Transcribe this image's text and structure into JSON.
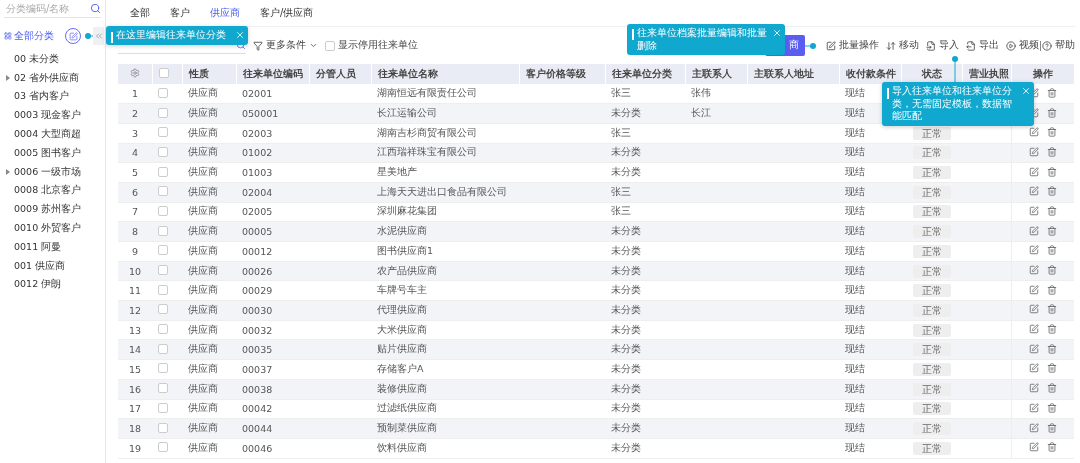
{
  "sidebar": {
    "search": {
      "placeholder": "分类编码/名称"
    },
    "tree": {
      "label": "全部分类",
      "selected": true,
      "children": [
        {
          "label": "00 未分类",
          "selected": false,
          "has_children": false
        },
        {
          "label": "02 省外供应商",
          "selected": false,
          "has_children": true
        },
        {
          "label": "03 省内客户",
          "selected": false,
          "has_children": false
        },
        {
          "label": "0003 现金客户",
          "selected": false,
          "has_children": false
        },
        {
          "label": "0004 大型商超",
          "selected": false,
          "has_children": false
        },
        {
          "label": "0005 图书客户",
          "selected": false,
          "has_children": false
        },
        {
          "label": "0006 一级市场",
          "selected": false,
          "has_children": true
        },
        {
          "label": "0008 北京客户",
          "selected": false,
          "has_children": false
        },
        {
          "label": "0009 苏州客户",
          "selected": false,
          "has_children": false
        },
        {
          "label": "0010 外贸客户",
          "selected": false,
          "has_children": false
        },
        {
          "label": "0011 阿曼",
          "selected": false,
          "has_children": false
        },
        {
          "label": "001 供应商",
          "selected": false,
          "has_children": false
        },
        {
          "label": "0012 伊朗",
          "selected": false,
          "has_children": false
        }
      ]
    }
  },
  "tabs": [
    {
      "label": "全部",
      "selected": false
    },
    {
      "label": "客户",
      "selected": false
    },
    {
      "label": "供应商",
      "selected": true
    },
    {
      "label": "客户/供应商",
      "selected": false
    }
  ],
  "toolbar": {
    "more_filters": "更多条件",
    "show_disabled": {
      "label": "显示停用往来单位",
      "checked": false
    },
    "primary_button": "商",
    "actions": [
      {
        "kind": "batch",
        "label": "批量操作"
      },
      {
        "kind": "move",
        "label": "移动"
      },
      {
        "kind": "import",
        "label": "导入"
      },
      {
        "kind": "export",
        "label": "导出"
      },
      {
        "kind": "video",
        "label": "视频"
      },
      {
        "kind": "help",
        "label": "帮助"
      }
    ]
  },
  "table": {
    "header_checked": false,
    "columns": [
      "性质",
      "往来单位编码",
      "分管人员",
      "往来单位名称",
      "客户价格等级",
      "往来单位分类",
      "主联系人",
      "主联系人地址",
      "收付款条件",
      "状态",
      "营业执照",
      "操作"
    ],
    "rows": [
      {
        "no": "1",
        "checked": false,
        "type": "供应商",
        "code": "02001",
        "name": "湖南恒远有限责任公司",
        "category": "张三",
        "contact": "张伟",
        "terms": "现结"
      },
      {
        "no": "2",
        "checked": false,
        "type": "供应商",
        "code": "050001",
        "name": "长江运输公司",
        "category": "未分类",
        "contact": "长江",
        "terms": "现结"
      },
      {
        "no": "3",
        "checked": false,
        "type": "供应商",
        "code": "02003",
        "name": "湖南吉杉商贸有限公司",
        "category": "张三",
        "terms": "现结",
        "status": "正常"
      },
      {
        "no": "4",
        "checked": false,
        "type": "供应商",
        "code": "01002",
        "name": "江西瑞祥珠宝有限公司",
        "category": "未分类",
        "terms": "现结",
        "status": "正常"
      },
      {
        "no": "5",
        "checked": false,
        "type": "供应商",
        "code": "01003",
        "name": "星美地产",
        "category": "未分类",
        "terms": "现结",
        "status": "正常"
      },
      {
        "no": "6",
        "checked": false,
        "type": "供应商",
        "code": "02004",
        "name": "上海天天进出口食品有限公司",
        "category": "张三",
        "terms": "现结",
        "status": "正常"
      },
      {
        "no": "7",
        "checked": false,
        "type": "供应商",
        "code": "02005",
        "name": "深圳麻花集团",
        "category": "张三",
        "terms": "现结",
        "status": "正常"
      },
      {
        "no": "8",
        "checked": false,
        "type": "供应商",
        "code": "00005",
        "name": "水泥供应商",
        "category": "未分类",
        "terms": "现结",
        "status": "正常"
      },
      {
        "no": "9",
        "checked": false,
        "type": "供应商",
        "code": "00012",
        "name": "图书供应商1",
        "category": "未分类",
        "terms": "现结",
        "status": "正常"
      },
      {
        "no": "10",
        "checked": false,
        "type": "供应商",
        "code": "00026",
        "name": "农产品供应商",
        "category": "未分类",
        "terms": "现结",
        "status": "正常"
      },
      {
        "no": "11",
        "checked": false,
        "type": "供应商",
        "code": "00029",
        "name": "车牌号车主",
        "category": "未分类",
        "terms": "现结",
        "status": "正常"
      },
      {
        "no": "12",
        "checked": false,
        "type": "供应商",
        "code": "00030",
        "name": "代理供应商",
        "category": "未分类",
        "terms": "现结",
        "status": "正常"
      },
      {
        "no": "13",
        "checked": false,
        "type": "供应商",
        "code": "00032",
        "name": "大米供应商",
        "category": "未分类",
        "terms": "现结",
        "status": "正常"
      },
      {
        "no": "14",
        "checked": false,
        "type": "供应商",
        "code": "00035",
        "name": "贴片供应商",
        "category": "未分类",
        "terms": "现结",
        "status": "正常"
      },
      {
        "no": "15",
        "checked": false,
        "type": "供应商",
        "code": "00037",
        "name": "存储客户A",
        "category": "未分类",
        "terms": "现结",
        "status": "正常"
      },
      {
        "no": "16",
        "checked": false,
        "type": "供应商",
        "code": "00038",
        "name": "装修供应商",
        "category": "未分类",
        "terms": "现结",
        "status": "正常"
      },
      {
        "no": "17",
        "checked": false,
        "type": "供应商",
        "code": "00042",
        "name": "过滤纸供应商",
        "category": "未分类",
        "terms": "现结",
        "status": "正常"
      },
      {
        "no": "18",
        "checked": false,
        "type": "供应商",
        "code": "00044",
        "name": "预制菜供应商",
        "category": "未分类",
        "terms": "现结",
        "status": "正常"
      },
      {
        "no": "19",
        "checked": false,
        "type": "供应商",
        "code": "00046",
        "name": "饮料供应商",
        "category": "未分类",
        "terms": "现结",
        "status": "正常"
      }
    ]
  },
  "tips": [
    {
      "kind": "category",
      "text": "在这里编辑往来单位分类"
    },
    {
      "kind": "batch",
      "text": "往来单位档案批量编辑和批量删除"
    },
    {
      "kind": "import",
      "text": "导入往来单位和往来单位分类，无需固定模板，数据智能匹配"
    }
  ]
}
